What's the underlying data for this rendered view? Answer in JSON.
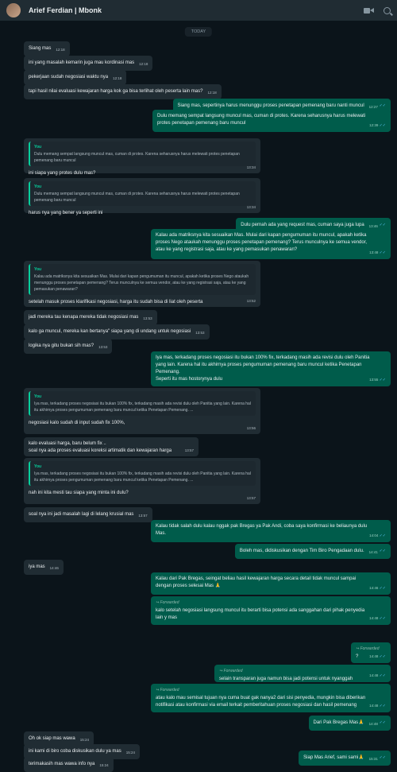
{
  "header": {
    "title": "Arief Ferdian | Mbonk",
    "icons": [
      "video-call-icon",
      "search-icon"
    ]
  },
  "date_chip": "TODAY",
  "messages": [
    {
      "text": "Siang mas",
      "time": "12:18"
    },
    {
      "text": "ini yang masalah kemarin juga mau kordinasi mas",
      "time": "12:18"
    },
    {
      "text": "pekerjaan sudah negosiasi waktu nya",
      "time": "12:18"
    },
    {
      "text": "tapi hasil nilai evaluasi kewajaran harga kok ga bisa terlihat oleh peserta lain mas?",
      "time": "12:18"
    },
    {
      "text": "Siang mas, sepertinya harus menunggu proses penetapan pemenang baru nanti muncul",
      "time": "12:27"
    },
    {
      "text": "Dulu memang sempat langsung muncul mas, cuman di protes. Karena seharusnya harus melewati\nprotes penetapan pemenang baru muncul",
      "time": "12:39"
    },
    {
      "quote_author": "You",
      "quote": "Dulu memang sempat langsung muncul mas, cuman di protes. Karena seharusnya harus melewati protes penetapan pemenang baru muncul",
      "text": "ini siapa yang protes dulu mas?",
      "time": "13:34"
    },
    {
      "quote_author": "You",
      "quote": "Dulu memang sempat langsung muncul mas, cuman di protes. Karena seharusnya harus melewati protes penetapan pemenang baru muncul",
      "text": "harus nya yang bener ya seperti ini",
      "time": "13:34"
    },
    {
      "text": "Dulu pernah ada yang request mas, cuman saya juga lupa",
      "time": "13:46"
    },
    {
      "text": "Kalau ada matriksnya kita sesuaikan Mas. Mulai dari kapan pengumuman itu muncul, apakah ketika\nproses Nego ataukah menunggu proses penetapan pemenang? Terus munculnya ke semua vendor,\natau ke yang registrasi saja, atau ke yang pemasukan penawaran?",
      "time": "13:48"
    },
    {
      "quote_author": "You",
      "quote": "Kalau ada matriksnya kita sesuaikan Mas. Mulai dari kapan pengumuman itu muncul, apakah ketika proses Nego ataukah menunggu proses penetapan pemenang? Terus munculnya ke semua vendor, atau ke yang registrasi saja, atau ke yang pemasukan penawaran?",
      "text": "setelah masuk proses klarifikasi negosiasi, harga itu sudah bisa di liat oleh peserta",
      "time": "13:52"
    },
    {
      "text": "jadi mereka tau kenapa mereka tidak negosiasi mas",
      "time": "13:53"
    },
    {
      "text": "kalo ga muncul, mereka kan bertanya\" siapa yang di undang untuk negosiasi",
      "time": "13:53"
    },
    {
      "text": "logika nya gitu bukan sih mas?",
      "time": "13:53"
    },
    {
      "text": "Iya mas, terkadang proses negosiasi itu bukan 100% fix, terkadang masih ada revisi dulu oleh Panitia\nyang lain. Karena hal itu akhirnya proses pengumuman pemenang baru muncul ketika Penetapan\nPemenang.\nSeperti itu mas hostorynya dulu",
      "time": "13:55"
    },
    {
      "quote_author": "You",
      "quote": "Iya mas, terkadang proses negosiasi itu bukan 100% fix, terkadang masih ada revisi dulu oleh Panitia yang lain. Karena hal itu akhirnya proses pengumuman pemenang baru muncul ketika Penetapan Pemenang. ...",
      "text": "negosiasi kalo sudah di input sudah fix 100%,",
      "time": "13:56"
    },
    {
      "text": "kalo evaluasi harga, baru belum fix ..\nsoal nya ada proses evaluasi koreksi artimatik dan kewajaran harga",
      "time": "13:57"
    },
    {
      "quote_author": "You",
      "quote": "Iya mas, terkadang proses negosiasi itu bukan 100% fix, terkadang masih ada revisi dulu oleh Panitia yang lain. Karena hal itu akhirnya proses pengumuman pemenang baru muncul ketika Penetapan Pemenang. ...",
      "text": "nah ini kita mesti tau siapa yang minta ini dulu?",
      "time": "13:57"
    },
    {
      "text": "soal nya ini jadi masalah lagi di lelang krusial mas",
      "time": "13:57"
    },
    {
      "text": "Kalau tidak salah dulu kalau nggak pak Bregas ya Pak Andi, coba saya konfirmasi ke beliaunya dulu\nMas.",
      "time": "14:04"
    },
    {
      "text": "Boleh mas, didiskusikan dengan Tim Biro Pengadaan dulu.",
      "time": "14:41"
    },
    {
      "text": "iya mas",
      "time": "14:46"
    },
    {
      "text": "Kalau dari Pak Bregas, seingat beliau hasil kewajaran harga secara detail tidak muncul sampai\ndengan proses selesai Mas 🙏",
      "time": "14:46"
    },
    {
      "forwarded": "Forwarded",
      "text": "kalo setelah negosiasi langsung muncul itu berarti bisa potensi ada sanggahan dari pihak penyedia\nlain y mas",
      "time": "14:48"
    },
    {
      "forwarded": "Forwarded",
      "text": "?",
      "time": "14:48"
    },
    {
      "forwarded": "Forwarded",
      "text": "selain transparan juga namun bisa jadi potensi untuk nyanggah",
      "time": "14:48"
    },
    {
      "forwarded": "Forwarded",
      "text": "atau kalo mau semisal tujuan nya cuma buat gak nanya2 dari sisi penyedia, mungkin bisa diberikan\nnotifikasi atau konfirmasi via email terkait pemberitahuan proses negosiasi dan hasil pemenang",
      "time": "14:48"
    },
    {
      "text": "Dari Pak Bregas Mas🙏",
      "time": "14:48"
    },
    {
      "text": "Oh ok siap mas wawa",
      "time": "15:24"
    },
    {
      "text": "ini kami di biro coba diskusikan dulu ya mas",
      "time": "15:24"
    },
    {
      "text": "terimakasih mas wawa info nya",
      "time": "15:24"
    },
    {
      "text": "Siap Mas Arief, sami sami🙏",
      "time": "15:31"
    }
  ]
}
